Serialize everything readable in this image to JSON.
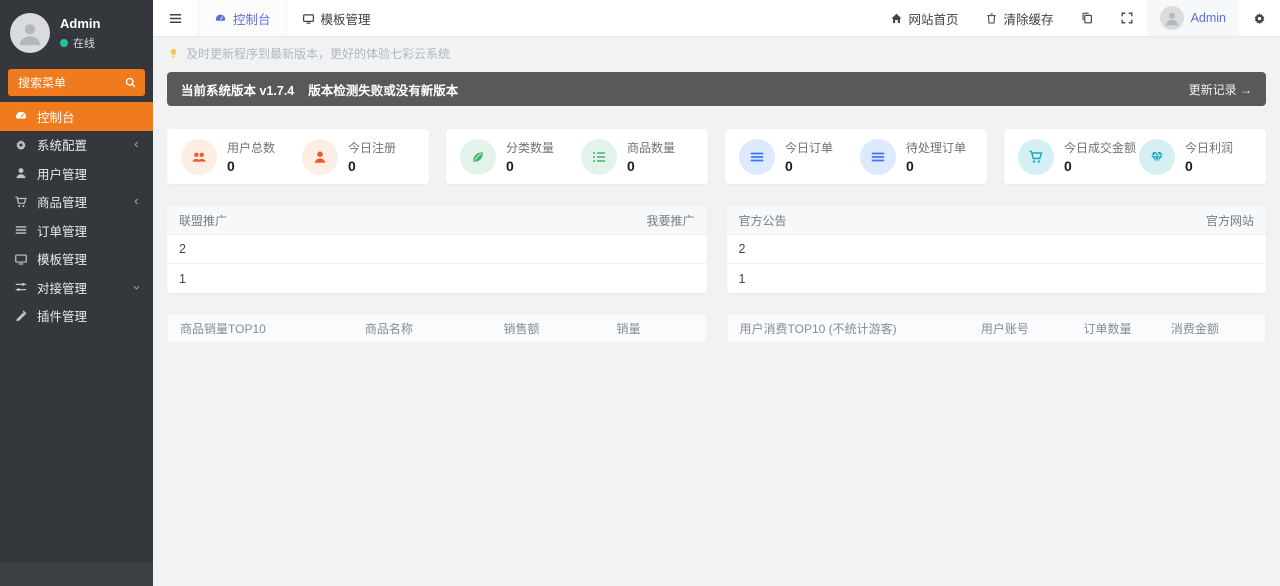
{
  "colors": {
    "accent_orange": "#ef7b1e",
    "active_blue": "#5b6fd6",
    "banner_gray": "#58595b",
    "online_green": "#22c3a0",
    "stat_orange": "#f4582b",
    "stat_green": "#3cb36a",
    "stat_blue": "#3d77f7",
    "stat_teal": "#16aab8"
  },
  "sidebar": {
    "user": {
      "name": "Admin",
      "status": "在线"
    },
    "search_placeholder": "搜索菜单",
    "menu": [
      {
        "label": "控制台"
      },
      {
        "label": "系统配置"
      },
      {
        "label": "用户管理"
      },
      {
        "label": "商品管理"
      },
      {
        "label": "订单管理"
      },
      {
        "label": "模板管理"
      },
      {
        "label": "对接管理"
      },
      {
        "label": "插件管理"
      }
    ]
  },
  "navbar": {
    "tabs": [
      {
        "label": "控制台"
      },
      {
        "label": "模板管理"
      }
    ],
    "links": [
      {
        "label": "网站首页"
      },
      {
        "label": "清除缓存"
      }
    ],
    "user": "Admin"
  },
  "notice": "及时更新程序到最新版本，更好的体验七彩云系统",
  "banner": {
    "version": "当前系统版本 v1.7.4",
    "status": "版本检测失败或没有新版本",
    "action": "更新记录 →"
  },
  "stats": [
    {
      "items": [
        {
          "label": "用户总数",
          "value": "0"
        },
        {
          "label": "今日注册",
          "value": "0"
        }
      ]
    },
    {
      "items": [
        {
          "label": "分类数量",
          "value": "0"
        },
        {
          "label": "商品数量",
          "value": "0"
        }
      ]
    },
    {
      "items": [
        {
          "label": "今日订单",
          "value": "0"
        },
        {
          "label": "待处理订单",
          "value": "0"
        }
      ]
    },
    {
      "items": [
        {
          "label": "今日成交金额",
          "value": "0"
        },
        {
          "label": "今日利润",
          "value": "0"
        }
      ]
    }
  ],
  "panels": [
    {
      "title": "联盟推广",
      "action": "我要推广",
      "rows": [
        "2",
        "1"
      ]
    },
    {
      "title": "官方公告",
      "action": "官方网站",
      "rows": [
        "2",
        "1"
      ]
    }
  ],
  "tables": [
    {
      "headers": [
        "商品销量TOP10",
        "商品名称",
        "销售额",
        "销量"
      ]
    },
    {
      "headers": [
        "用户消费TOP10 (不统计游客)",
        "用户账号",
        "订单数量",
        "消费金额"
      ]
    }
  ]
}
